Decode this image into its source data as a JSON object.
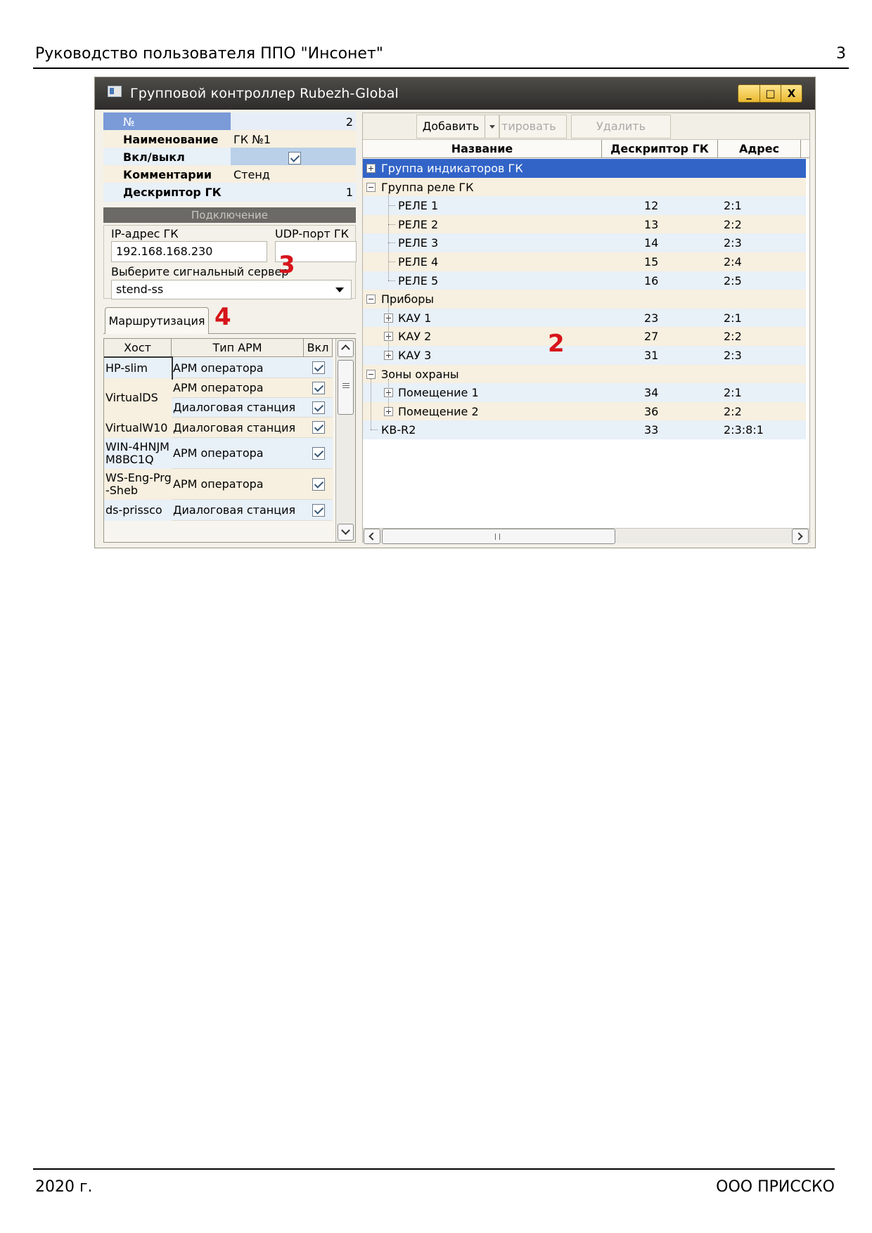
{
  "document": {
    "header_title": "Руководство пользователя ППО \"Инсонет\"",
    "page_number": "3",
    "footer_year": "2020 г.",
    "footer_org": "ООО ПРИССКО"
  },
  "window": {
    "title": "Групповой контроллер Rubezh-Global",
    "buttons": {
      "minimize": "_",
      "maximize": "□",
      "close": "X"
    }
  },
  "properties": [
    {
      "label": "№",
      "value": "2",
      "bg": "#7a9ad8",
      "vbg": "#e7eef7"
    },
    {
      "label": "Наименование",
      "value": "ГК №1",
      "bg": "#f7efdf",
      "vbg": "#f7efdf"
    },
    {
      "label": "Вкл/выкл",
      "value": "",
      "checkbox": true,
      "bg": "#e8f0f8",
      "vbg": "#b9d0e8"
    },
    {
      "label": "Комментарии",
      "value": "Стенд",
      "bg": "#f7efdf",
      "vbg": "#f7efdf"
    },
    {
      "label": "Дескриптор ГК",
      "value": "1",
      "bg": "#e8f0f8",
      "vbg": "#e8f0f8"
    }
  ],
  "connection": {
    "section_label": "Подключение",
    "ip_label": "IP-адрес ГК",
    "ip_value": "192.168.168.230",
    "udp_label": "UDP-порт ГК",
    "udp_value": "",
    "server_label": "Выберите сигнальный сервер",
    "server_value": "stend-ss"
  },
  "routing": {
    "tab_label": "Маршрутизация",
    "columns": [
      "Хост",
      "Тип АРМ",
      "Вкл"
    ],
    "rows": [
      {
        "host": "HP-slim",
        "type": "АРМ оператора",
        "enabled": true,
        "h": 29,
        "hostSpan": 1,
        "bg": "#e8f0f8",
        "focused": true
      },
      {
        "host": "VirtualDS",
        "type": "АРМ оператора",
        "enabled": true,
        "h": 28,
        "hostSpan": 2,
        "bg": "#f7efdf"
      },
      {
        "host": "",
        "type": "Диалоговая станция",
        "enabled": true,
        "h": 28,
        "hostSpan": 0,
        "bg": "#e8f0f8"
      },
      {
        "host": "VirtualW10",
        "type": "Диалоговая станция",
        "enabled": true,
        "h": 29,
        "hostSpan": 1,
        "bg": "#f7efdf"
      },
      {
        "host": "WIN-4HNJM M8BC1Q",
        "type": "АРМ оператора",
        "enabled": true,
        "h": 44,
        "hostSpan": 1,
        "bg": "#e8f0f8"
      },
      {
        "host": "WS-Eng-Prg -Sheb",
        "type": "АРМ оператора",
        "enabled": true,
        "h": 44,
        "hostSpan": 1,
        "bg": "#f7efdf"
      },
      {
        "host": "ds-prissco",
        "type": "Диалоговая станция",
        "enabled": true,
        "h": 30,
        "hostSpan": 1,
        "bg": "#e8f0f8"
      }
    ]
  },
  "toolbar": {
    "add": "Добавить",
    "edit": "тировать",
    "delete": "Удалить"
  },
  "tree": {
    "columns": [
      "Название",
      "Дескриптор ГК",
      "Адрес"
    ],
    "rows": [
      {
        "name": "Группа индикаторов ГК",
        "desc": "",
        "addr": "",
        "level": 0,
        "toggle": "plus",
        "selected": true
      },
      {
        "name": "Группа реле ГК",
        "desc": "",
        "addr": "",
        "level": 0,
        "toggle": "minus"
      },
      {
        "name": "РЕЛЕ 1",
        "desc": "12",
        "addr": "2:1",
        "level": 1,
        "toggle": "none"
      },
      {
        "name": "РЕЛЕ 2",
        "desc": "13",
        "addr": "2:2",
        "level": 1,
        "toggle": "none"
      },
      {
        "name": "РЕЛЕ 3",
        "desc": "14",
        "addr": "2:3",
        "level": 1,
        "toggle": "none"
      },
      {
        "name": "РЕЛЕ 4",
        "desc": "15",
        "addr": "2:4",
        "level": 1,
        "toggle": "none"
      },
      {
        "name": "РЕЛЕ 5",
        "desc": "16",
        "addr": "2:5",
        "level": 1,
        "toggle": "none"
      },
      {
        "name": "Приборы",
        "desc": "",
        "addr": "",
        "level": 0,
        "toggle": "minus"
      },
      {
        "name": "КАУ 1",
        "desc": "23",
        "addr": "2:1",
        "level": 1,
        "toggle": "plus"
      },
      {
        "name": "КАУ 2",
        "desc": "27",
        "addr": "2:2",
        "level": 1,
        "toggle": "plus"
      },
      {
        "name": "КАУ 3",
        "desc": "31",
        "addr": "2:3",
        "level": 1,
        "toggle": "plus"
      },
      {
        "name": "Зоны охраны",
        "desc": "",
        "addr": "",
        "level": 0,
        "toggle": "minus"
      },
      {
        "name": "Помещение 1",
        "desc": "34",
        "addr": "2:1",
        "level": 1,
        "toggle": "plus"
      },
      {
        "name": "Помещение 2",
        "desc": "36",
        "addr": "2:2",
        "level": 1,
        "toggle": "plus"
      },
      {
        "name": "КВ-R2",
        "desc": "33",
        "addr": "2:3:8:1",
        "level": 0,
        "toggle": "none"
      }
    ]
  },
  "annotations": {
    "mark2": "2",
    "mark3": "3",
    "mark4": "4"
  },
  "colors": {
    "row_blue": "#e8f0f8",
    "row_beige": "#f7efdf",
    "selection": "#3264c8",
    "annotation_red": "#d6141a"
  }
}
